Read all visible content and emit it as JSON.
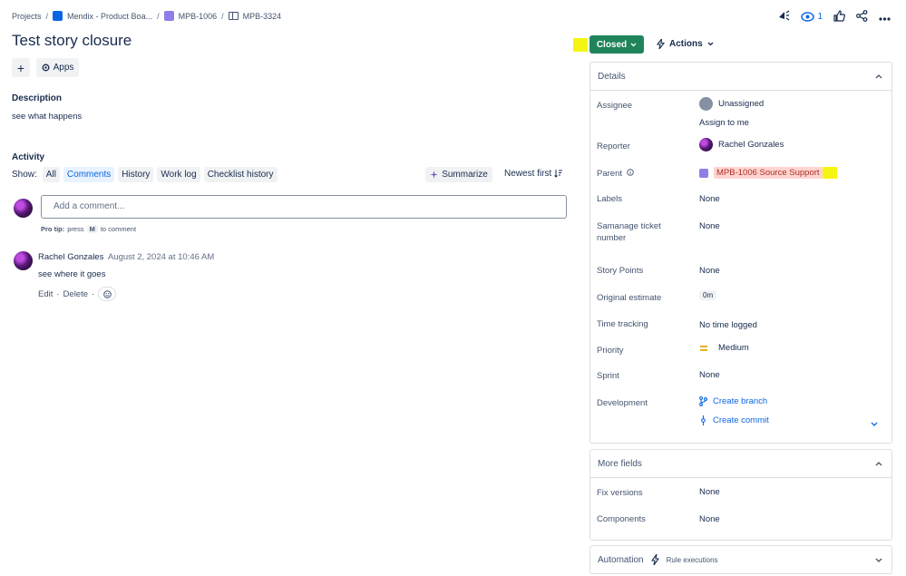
{
  "breadcrumb": {
    "projects": "Projects",
    "board": "Mendix - Product Boa...",
    "epic": "MPB-1006",
    "story": "MPB-3324",
    "separator": "/"
  },
  "top_icons": {
    "watch_count": "1"
  },
  "title": "Test story closure",
  "toolbar": {
    "add_label": "+",
    "apps_label": "Apps"
  },
  "description": {
    "heading": "Description",
    "text": "see what happens"
  },
  "activity": {
    "heading": "Activity",
    "show_label": "Show:",
    "filters": [
      "All",
      "Comments",
      "History",
      "Work log",
      "Checklist history"
    ],
    "summarize": "Summarize",
    "sort": "Newest first"
  },
  "comment_box": {
    "placeholder": "Add a comment...",
    "pro_tip_bold": "Pro tip:",
    "pro_tip_press": "press",
    "pro_tip_key": "M",
    "pro_tip_rest": "to comment"
  },
  "comment": {
    "author": "Rachel Gonzales",
    "date": "August 2, 2024 at 10:46 AM",
    "body": "see where it goes",
    "edit": "Edit",
    "delete": "Delete",
    "dot": "·"
  },
  "status": {
    "label": "Closed"
  },
  "actions": {
    "label": "Actions"
  },
  "details": {
    "heading": "Details",
    "assignee_label": "Assignee",
    "assignee_value": "Unassigned",
    "assign_to_me": "Assign to me",
    "reporter_label": "Reporter",
    "reporter_value": "Rachel Gonzales",
    "parent_label": "Parent",
    "parent_value": "MPB-1006 Source Support",
    "labels_label": "Labels",
    "labels_value": "None",
    "samanage_label_1": "Samanage ticket",
    "samanage_label_2": "number",
    "samanage_value": "None",
    "story_points_label": "Story Points",
    "story_points_value": "None",
    "orig_est_label": "Original estimate",
    "orig_est_value": "0m",
    "time_tracking_label": "Time tracking",
    "time_tracking_value": "No time logged",
    "priority_label": "Priority",
    "priority_value": "Medium",
    "sprint_label": "Sprint",
    "sprint_value": "None",
    "development_label": "Development",
    "create_branch": "Create branch",
    "create_commit": "Create commit"
  },
  "more_fields": {
    "heading": "More fields",
    "fix_versions_label": "Fix versions",
    "fix_versions_value": "None",
    "components_label": "Components",
    "components_value": "None"
  },
  "automation": {
    "heading": "Automation",
    "rule_executions": "Rule executions"
  },
  "colors": {
    "status_green": "#1f845a",
    "link_blue": "#0c66e4",
    "highlight": "#f5f514",
    "parent_tag_bg": "#ffd5d2"
  }
}
